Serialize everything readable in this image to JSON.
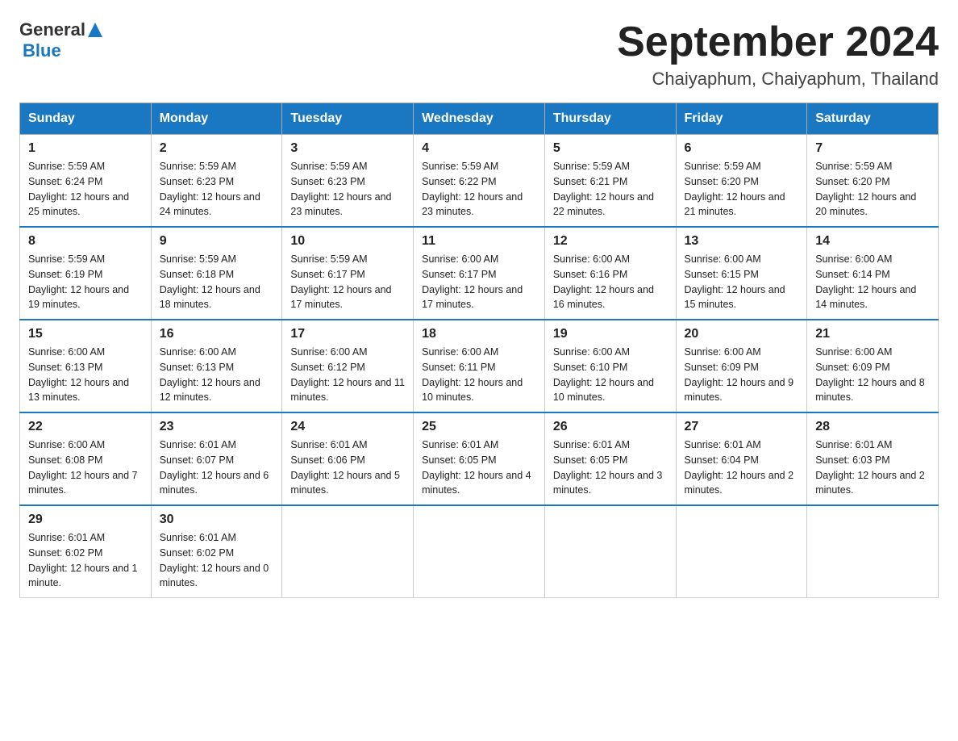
{
  "header": {
    "logo": {
      "general": "General",
      "blue": "Blue",
      "aria": "GeneralBlue logo"
    },
    "title": "September 2024",
    "subtitle": "Chaiyaphum, Chaiyaphum, Thailand"
  },
  "calendar": {
    "days_of_week": [
      "Sunday",
      "Monday",
      "Tuesday",
      "Wednesday",
      "Thursday",
      "Friday",
      "Saturday"
    ],
    "weeks": [
      [
        {
          "day": "1",
          "sunrise": "Sunrise: 5:59 AM",
          "sunset": "Sunset: 6:24 PM",
          "daylight": "Daylight: 12 hours and 25 minutes."
        },
        {
          "day": "2",
          "sunrise": "Sunrise: 5:59 AM",
          "sunset": "Sunset: 6:23 PM",
          "daylight": "Daylight: 12 hours and 24 minutes."
        },
        {
          "day": "3",
          "sunrise": "Sunrise: 5:59 AM",
          "sunset": "Sunset: 6:23 PM",
          "daylight": "Daylight: 12 hours and 23 minutes."
        },
        {
          "day": "4",
          "sunrise": "Sunrise: 5:59 AM",
          "sunset": "Sunset: 6:22 PM",
          "daylight": "Daylight: 12 hours and 23 minutes."
        },
        {
          "day": "5",
          "sunrise": "Sunrise: 5:59 AM",
          "sunset": "Sunset: 6:21 PM",
          "daylight": "Daylight: 12 hours and 22 minutes."
        },
        {
          "day": "6",
          "sunrise": "Sunrise: 5:59 AM",
          "sunset": "Sunset: 6:20 PM",
          "daylight": "Daylight: 12 hours and 21 minutes."
        },
        {
          "day": "7",
          "sunrise": "Sunrise: 5:59 AM",
          "sunset": "Sunset: 6:20 PM",
          "daylight": "Daylight: 12 hours and 20 minutes."
        }
      ],
      [
        {
          "day": "8",
          "sunrise": "Sunrise: 5:59 AM",
          "sunset": "Sunset: 6:19 PM",
          "daylight": "Daylight: 12 hours and 19 minutes."
        },
        {
          "day": "9",
          "sunrise": "Sunrise: 5:59 AM",
          "sunset": "Sunset: 6:18 PM",
          "daylight": "Daylight: 12 hours and 18 minutes."
        },
        {
          "day": "10",
          "sunrise": "Sunrise: 5:59 AM",
          "sunset": "Sunset: 6:17 PM",
          "daylight": "Daylight: 12 hours and 17 minutes."
        },
        {
          "day": "11",
          "sunrise": "Sunrise: 6:00 AM",
          "sunset": "Sunset: 6:17 PM",
          "daylight": "Daylight: 12 hours and 17 minutes."
        },
        {
          "day": "12",
          "sunrise": "Sunrise: 6:00 AM",
          "sunset": "Sunset: 6:16 PM",
          "daylight": "Daylight: 12 hours and 16 minutes."
        },
        {
          "day": "13",
          "sunrise": "Sunrise: 6:00 AM",
          "sunset": "Sunset: 6:15 PM",
          "daylight": "Daylight: 12 hours and 15 minutes."
        },
        {
          "day": "14",
          "sunrise": "Sunrise: 6:00 AM",
          "sunset": "Sunset: 6:14 PM",
          "daylight": "Daylight: 12 hours and 14 minutes."
        }
      ],
      [
        {
          "day": "15",
          "sunrise": "Sunrise: 6:00 AM",
          "sunset": "Sunset: 6:13 PM",
          "daylight": "Daylight: 12 hours and 13 minutes."
        },
        {
          "day": "16",
          "sunrise": "Sunrise: 6:00 AM",
          "sunset": "Sunset: 6:13 PM",
          "daylight": "Daylight: 12 hours and 12 minutes."
        },
        {
          "day": "17",
          "sunrise": "Sunrise: 6:00 AM",
          "sunset": "Sunset: 6:12 PM",
          "daylight": "Daylight: 12 hours and 11 minutes."
        },
        {
          "day": "18",
          "sunrise": "Sunrise: 6:00 AM",
          "sunset": "Sunset: 6:11 PM",
          "daylight": "Daylight: 12 hours and 10 minutes."
        },
        {
          "day": "19",
          "sunrise": "Sunrise: 6:00 AM",
          "sunset": "Sunset: 6:10 PM",
          "daylight": "Daylight: 12 hours and 10 minutes."
        },
        {
          "day": "20",
          "sunrise": "Sunrise: 6:00 AM",
          "sunset": "Sunset: 6:09 PM",
          "daylight": "Daylight: 12 hours and 9 minutes."
        },
        {
          "day": "21",
          "sunrise": "Sunrise: 6:00 AM",
          "sunset": "Sunset: 6:09 PM",
          "daylight": "Daylight: 12 hours and 8 minutes."
        }
      ],
      [
        {
          "day": "22",
          "sunrise": "Sunrise: 6:00 AM",
          "sunset": "Sunset: 6:08 PM",
          "daylight": "Daylight: 12 hours and 7 minutes."
        },
        {
          "day": "23",
          "sunrise": "Sunrise: 6:01 AM",
          "sunset": "Sunset: 6:07 PM",
          "daylight": "Daylight: 12 hours and 6 minutes."
        },
        {
          "day": "24",
          "sunrise": "Sunrise: 6:01 AM",
          "sunset": "Sunset: 6:06 PM",
          "daylight": "Daylight: 12 hours and 5 minutes."
        },
        {
          "day": "25",
          "sunrise": "Sunrise: 6:01 AM",
          "sunset": "Sunset: 6:05 PM",
          "daylight": "Daylight: 12 hours and 4 minutes."
        },
        {
          "day": "26",
          "sunrise": "Sunrise: 6:01 AM",
          "sunset": "Sunset: 6:05 PM",
          "daylight": "Daylight: 12 hours and 3 minutes."
        },
        {
          "day": "27",
          "sunrise": "Sunrise: 6:01 AM",
          "sunset": "Sunset: 6:04 PM",
          "daylight": "Daylight: 12 hours and 2 minutes."
        },
        {
          "day": "28",
          "sunrise": "Sunrise: 6:01 AM",
          "sunset": "Sunset: 6:03 PM",
          "daylight": "Daylight: 12 hours and 2 minutes."
        }
      ],
      [
        {
          "day": "29",
          "sunrise": "Sunrise: 6:01 AM",
          "sunset": "Sunset: 6:02 PM",
          "daylight": "Daylight: 12 hours and 1 minute."
        },
        {
          "day": "30",
          "sunrise": "Sunrise: 6:01 AM",
          "sunset": "Sunset: 6:02 PM",
          "daylight": "Daylight: 12 hours and 0 minutes."
        },
        null,
        null,
        null,
        null,
        null
      ]
    ]
  }
}
